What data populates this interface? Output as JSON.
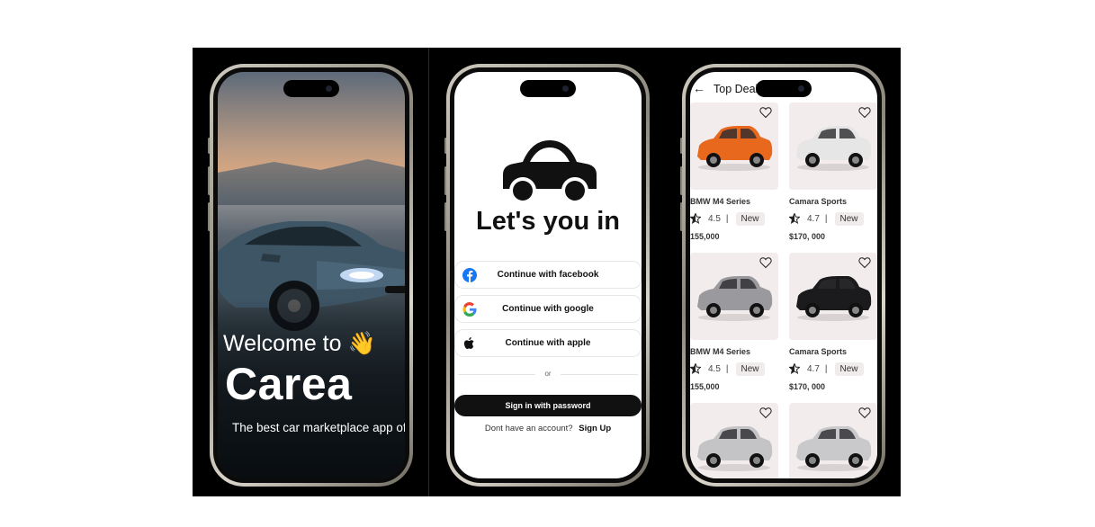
{
  "screens": {
    "onboarding": {
      "welcome": "Welcome to 👋",
      "brand": "Carea",
      "tagline": "The best car marketplace app of the century for your transportation"
    },
    "login": {
      "title": "Let's you in",
      "buttons": [
        {
          "label": "Continue with facebook",
          "icon": "facebook-icon"
        },
        {
          "label": "Continue with google",
          "icon": "google-icon"
        },
        {
          "label": "Continue with apple",
          "icon": "apple-icon"
        }
      ],
      "or": "or",
      "sign_in_password": "Sign in with password",
      "no_account": "Dont have an account?",
      "sign_up": "Sign Up"
    },
    "top_deals": {
      "title": "Top Deals",
      "back_icon": "arrow-left-icon",
      "cards": [
        {
          "name": "BMW M4 Series",
          "rating": "4.5",
          "separator": "|",
          "badge": "New",
          "price": "155,000",
          "car_color": "#e8681e"
        },
        {
          "name": "Camara Sports",
          "rating": "4.7",
          "separator": "|",
          "badge": "New",
          "price": "$170, 000",
          "car_color": "#e6e6e6"
        },
        {
          "name": "BMW M4 Series",
          "rating": "4.5",
          "separator": "|",
          "badge": "New",
          "price": "155,000",
          "car_color": "#9a9a9e"
        },
        {
          "name": "Camara Sports",
          "rating": "4.7",
          "separator": "|",
          "badge": "New",
          "price": "$170, 000",
          "car_color": "#1b1b1d"
        },
        {
          "car_color": "#c4c4c6"
        },
        {
          "car_color": "#c9c9cb"
        }
      ]
    }
  },
  "colors": {
    "accent": "#111111",
    "card_bg": "#f3ecec",
    "facebook": "#1877f2"
  }
}
